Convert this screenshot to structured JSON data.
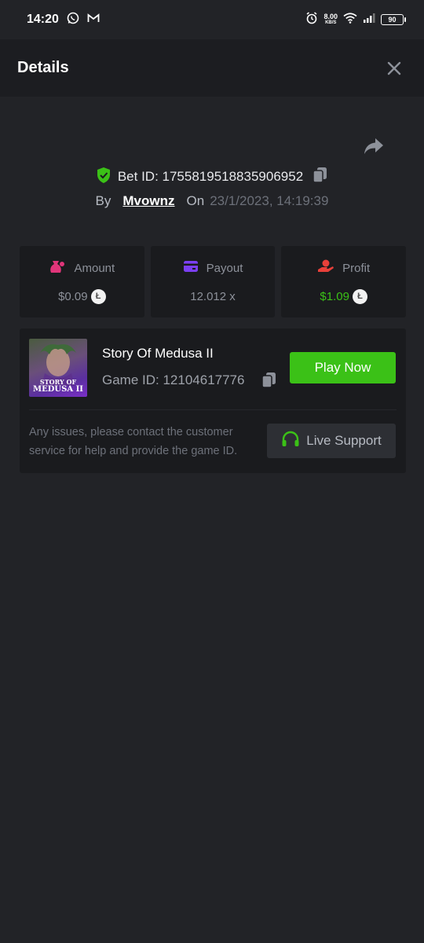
{
  "status_bar": {
    "time": "14:20",
    "net_speed": "8.00",
    "net_unit": "KB/S",
    "battery": "90"
  },
  "header": {
    "title": "Details"
  },
  "bet": {
    "id_label": "Bet ID: 1755819518835906952",
    "by_label": "By",
    "username": "Mvownz",
    "on_label": "On",
    "date": "23/1/2023, 14:19:39"
  },
  "stats": [
    {
      "label": "Amount",
      "value": "$0.09",
      "icon": "money-bag-icon"
    },
    {
      "label": "Payout",
      "value": "12.012 x",
      "icon": "credit-card-icon"
    },
    {
      "label": "Profit",
      "value": "$1.09",
      "icon": "hand-coin-icon"
    }
  ],
  "game": {
    "thumb_line1": "STORY OF",
    "thumb_line2": "MEDUSA II",
    "title": "Story Of Medusa II",
    "id_label": "Game ID: 12104617776",
    "play_label": "Play Now",
    "issue_text": "Any issues, please contact the customer service for help and provide the game ID.",
    "support_label": "Live Support"
  },
  "colors": {
    "accent_green": "#3bc117",
    "shield_green": "#3bc117",
    "amount_icon": "#e0357a",
    "payout_icon": "#7b3ff2",
    "profit_icon": "#e8403a",
    "background": "#222327",
    "card": "#1a1b1e"
  }
}
